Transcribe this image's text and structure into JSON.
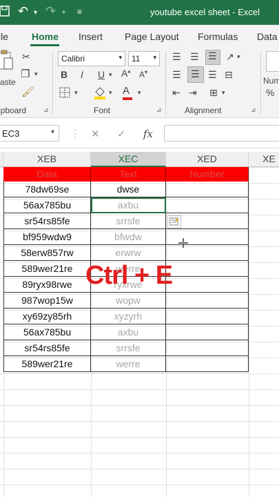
{
  "titlebar": {
    "title": "youtube excel sheet  -  Excel"
  },
  "tabs": [
    "ile",
    "Home",
    "Insert",
    "Page Layout",
    "Formulas",
    "Data"
  ],
  "ribbon": {
    "paste_label": "aste",
    "clipboard_label": "ipboard",
    "font_name": "Calibri",
    "font_size": "11",
    "font_label": "Font",
    "alignment_label": "Alignment",
    "number_label": "Num",
    "bold": "B",
    "italic": "I",
    "underline": "U",
    "font_color_letter": "A"
  },
  "formula_bar": {
    "name_box": "EC3",
    "fx": "fx"
  },
  "columns": [
    {
      "label": "XEB",
      "selected": false
    },
    {
      "label": "XEC",
      "selected": true
    },
    {
      "label": "XED",
      "selected": false
    },
    {
      "label": "XE",
      "selected": false
    }
  ],
  "table": {
    "headers": [
      "Data",
      "Text",
      "Number"
    ],
    "rows": [
      {
        "data": "78dw69se",
        "text": "dwse",
        "text_style": "typed"
      },
      {
        "data": "56ax785bu",
        "text": "axbu",
        "text_style": "preview"
      },
      {
        "data": "sr54rs85fe",
        "text": "srrsfe",
        "text_style": "preview"
      },
      {
        "data": "bf959wdw9",
        "text": "bfwdw",
        "text_style": "preview"
      },
      {
        "data": "58erw857rw",
        "text": "erwrw",
        "text_style": "preview"
      },
      {
        "data": "589wer21re",
        "text": "werre",
        "text_style": "preview"
      },
      {
        "data": "89ryx98rwe",
        "text": "ryxrwe",
        "text_style": "preview"
      },
      {
        "data": "987wop15w",
        "text": "wopw",
        "text_style": "preview"
      },
      {
        "data": "xy69zy85rh",
        "text": "xyzyrh",
        "text_style": "preview"
      },
      {
        "data": "56ax785bu",
        "text": "axbu",
        "text_style": "preview"
      },
      {
        "data": "sr54rs85fe",
        "text": "srrsfe",
        "text_style": "preview"
      },
      {
        "data": "589wer21re",
        "text": "werre",
        "text_style": "preview"
      }
    ]
  },
  "overlay": {
    "shortcut": "Ctrl + E"
  },
  "colors": {
    "accent": "#217346",
    "header_fill": "#ff0000",
    "header_text": "#d94b4b",
    "overlay_text": "#e02020",
    "preview_text": "#a6a6a6"
  }
}
